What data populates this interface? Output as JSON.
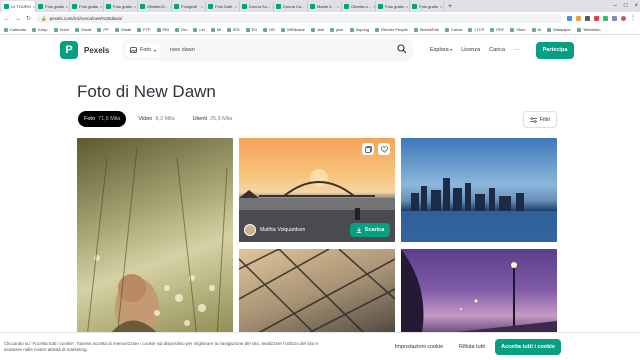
{
  "browser": {
    "tabs": [
      "Le TOURO",
      "Foto gratis",
      "Foto gratis",
      "Foto gratis",
      "Olivetta D...",
      "Fotografi",
      "Foto Dafit",
      "Donna Su...",
      "Donna Ca...",
      "Madre li...",
      "Olivetta o...",
      "Foto gratis",
      "Foto gratis"
    ],
    "url": "pexels.com/it-it/cerca/new%20dawn/",
    "bookmarks": [
      "Calendar",
      "Keep",
      "Drive",
      "Gmail",
      "PP",
      "Gmail",
      "FTF",
      "PBI",
      "Gm",
      "Lei",
      "Mi",
      "IED",
      "ED",
      "HD",
      "WEBcube",
      "Jedi",
      "pixir",
      "Xspring",
      "Render People",
      "SketchFab",
      "Canva",
      "LTCP",
      "PDF",
      "Skeu",
      "Ai",
      "Wallpaper",
      "Television"
    ]
  },
  "header": {
    "brand": "Pexels",
    "search_type": "Foto",
    "search_value": "new dawn",
    "nav": {
      "explore": "Esplora",
      "license": "Licenza",
      "upload": "Carica",
      "more": "···",
      "join": "Partecipa"
    }
  },
  "page": {
    "title": "Foto di New Dawn",
    "tabs": [
      {
        "label": "Foto",
        "count": "71,5 Mila"
      },
      {
        "label": "Video",
        "count": "8,3 Mila"
      },
      {
        "label": "Utenti",
        "count": "25,3 Mila"
      }
    ],
    "filter": "Filtri"
  },
  "photo": {
    "author": "Matthis Volquardsen",
    "download": "Scarica"
  },
  "cookie": {
    "text": "Cliccando su \"Accetta tutti i cookie\", l'utente accetta di memorizzare i cookie sul dispositivo per migliorare la navigazione del sito, analizzare l'utilizzo del sito e assistere nelle nostre attività di marketing.",
    "manage": "Impostazioni cookie",
    "reject": "Rifiuta tutti",
    "accept": "Accetta tutti i cookie"
  }
}
